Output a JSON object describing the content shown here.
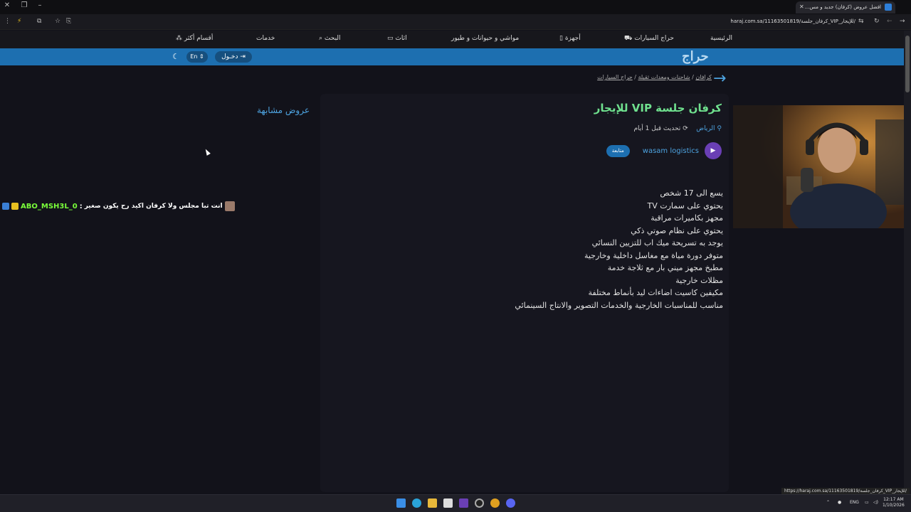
{
  "browser": {
    "tab_title": "افضل عروض (كرفان) جديد و مس...",
    "url": "haraj.com.sa/11163501819/كرفان_جلسة_VIP_للإيجار/",
    "status_url": "https://haraj.com.sa/11163501819/كرفان_جلسة_VIP_للإيجار/"
  },
  "nav": {
    "items": [
      "الرئيسية",
      "حراج السيارات",
      "أجهزة",
      "مواشي و حيوانات و طيور",
      "اثاث",
      "البحث",
      "خدمات",
      "أقسام أكثر"
    ]
  },
  "header": {
    "logo": "حراج",
    "login_label": "دخـول",
    "lang_label": "En"
  },
  "breadcrumb": {
    "items": [
      "حراج السيارات",
      "شاحنات ومعدات ثقيلة",
      "كرافان"
    ]
  },
  "ad": {
    "title": "كرفان جلسة VIP للإيجار",
    "city": "الرياض",
    "updated": "تحديث قبل 1 أيام",
    "seller_name": "wasam logistics",
    "follow_label": "متابعة",
    "description": [
      "يسع الى 17 شخص",
      "يحتوي على سمارت TV",
      "مجهز بكاميرات مراقبة",
      "يحتوي على نظام صوتي ذكي",
      "يوجد به تسريحة ميك اب للتزيين النسائي",
      "متوفر دورة مياة مع مغاسل داخلية وخارجية",
      "مطبخ مجهز ميني بار مع ثلاجة خدمة",
      "مظلات خارجية",
      "مكيفين كاسيت اضاءات ليد بأنماط مختلفة",
      "مناسب للمناسبات الخارجية والخدمات التصوير والانتاج السينمائي"
    ]
  },
  "sidebar": {
    "similar_title": "عروض مشابهة"
  },
  "chat": {
    "username": "ABO_MSH3L_0",
    "separator": ":",
    "message": "انت تبا مجلس ولا كرفان اكيد رح يكون صغير"
  },
  "taskbar": {
    "lang": "ENG",
    "time": "12:17 AM",
    "date": "1/10/2026"
  }
}
